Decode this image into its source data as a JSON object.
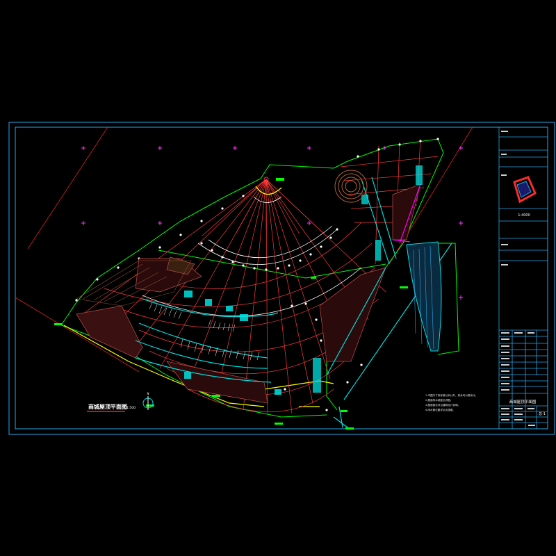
{
  "drawing": {
    "title": "商城屋顶平面图",
    "scale": "1:500",
    "north_label": "N",
    "title_block": {
      "project_name": "商城屋顶平面图",
      "key_plan_scale": "1:4000",
      "sheet_no": "总-1",
      "field_labels": [
        "工程名称",
        "子项名称",
        "图名",
        "图号",
        "比例",
        "日期",
        "设计",
        "校对",
        "审核",
        "审定"
      ]
    },
    "notes": [
      "1.本图尺寸除标高以米计外，其余均以毫米计。",
      "2.屋面排水坡度见详图。",
      "3.屋面做法详见建筑设计说明。",
      "4.雨水管位置详见水施图。"
    ]
  },
  "colors": {
    "background": "#000000",
    "frame": "#2aa7e8",
    "site_lines": "#00ff00",
    "grid_lines": "#ff3333",
    "building": "#00e0e0",
    "landscape": "#ffff00",
    "accent": "#ff00ff",
    "walls": "#ffffff"
  }
}
